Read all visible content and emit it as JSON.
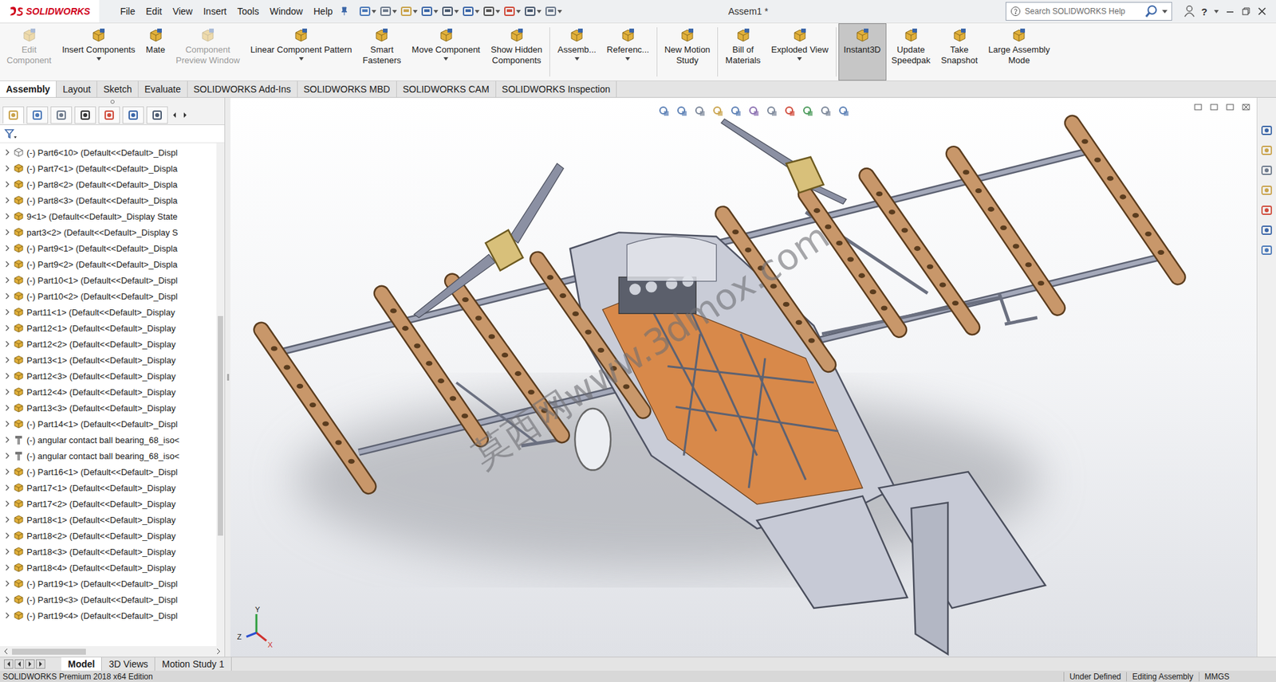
{
  "window": {
    "title": "Assem1 *"
  },
  "app": {
    "logo": "SOLIDWORKS"
  },
  "menu": [
    "File",
    "Edit",
    "View",
    "Insert",
    "Tools",
    "Window",
    "Help"
  ],
  "search": {
    "placeholder": "Search SOLIDWORKS Help"
  },
  "help_button": "?",
  "ribbon": [
    {
      "lines": [
        "Edit",
        "Component"
      ],
      "disabled": true,
      "selected": false,
      "menu": false
    },
    {
      "lines": [
        "Insert Components"
      ],
      "disabled": false,
      "selected": false,
      "menu": true
    },
    {
      "lines": [
        "Mate"
      ],
      "disabled": false,
      "selected": false,
      "menu": false
    },
    {
      "lines": [
        "Component",
        "Preview Window"
      ],
      "disabled": true,
      "selected": false,
      "menu": false
    },
    {
      "lines": [
        "Linear Component Pattern"
      ],
      "disabled": false,
      "selected": false,
      "menu": true
    },
    {
      "lines": [
        "Smart",
        "Fasteners"
      ],
      "disabled": false,
      "selected": false,
      "menu": false
    },
    {
      "lines": [
        "Move Component"
      ],
      "disabled": false,
      "selected": false,
      "menu": true
    },
    {
      "lines": [
        "Show Hidden",
        "Components"
      ],
      "disabled": false,
      "selected": false,
      "menu": false
    },
    {
      "lines": [
        "Assemb..."
      ],
      "disabled": false,
      "selected": false,
      "menu": true
    },
    {
      "lines": [
        "Referenc..."
      ],
      "disabled": false,
      "selected": false,
      "menu": true
    },
    {
      "lines": [
        "New Motion",
        "Study"
      ],
      "disabled": false,
      "selected": false,
      "menu": false
    },
    {
      "lines": [
        "Bill of",
        "Materials"
      ],
      "disabled": false,
      "selected": false,
      "menu": false
    },
    {
      "lines": [
        "Exploded View"
      ],
      "disabled": false,
      "selected": false,
      "menu": true
    },
    {
      "lines": [
        "Instant3D"
      ],
      "disabled": false,
      "selected": true,
      "menu": false
    },
    {
      "lines": [
        "Update",
        "Speedpak"
      ],
      "disabled": false,
      "selected": false,
      "menu": false
    },
    {
      "lines": [
        "Take",
        "Snapshot"
      ],
      "disabled": false,
      "selected": false,
      "menu": false
    },
    {
      "lines": [
        "Large Assembly",
        "Mode"
      ],
      "disabled": false,
      "selected": false,
      "menu": false
    }
  ],
  "tabs": [
    {
      "label": "Assembly",
      "selected": true
    },
    {
      "label": "Layout",
      "selected": false
    },
    {
      "label": "Sketch",
      "selected": false
    },
    {
      "label": "Evaluate",
      "selected": false
    },
    {
      "label": "SOLIDWORKS Add-Ins",
      "selected": false
    },
    {
      "label": "SOLIDWORKS MBD",
      "selected": false
    },
    {
      "label": "SOLIDWORKS CAM",
      "selected": false
    },
    {
      "label": "SOLIDWORKS Inspection",
      "selected": false
    }
  ],
  "tree": [
    {
      "label": "(-) Part6<10> (Default<<Default>_Displ",
      "kind": "outline",
      "expanded": false
    },
    {
      "label": "(-) Part7<1> (Default<<Default>_Displa",
      "kind": "part",
      "expanded": false
    },
    {
      "label": "(-) Part8<2> (Default<<Default>_Displa",
      "kind": "part",
      "expanded": false
    },
    {
      "label": "(-) Part8<3> (Default<<Default>_Displa",
      "kind": "part",
      "expanded": false
    },
    {
      "label": "9<1> (Default<<Default>_Display State",
      "kind": "part",
      "expanded": false
    },
    {
      "label": "part3<2> (Default<<Default>_Display S",
      "kind": "part",
      "expanded": false
    },
    {
      "label": "(-) Part9<1> (Default<<Default>_Displa",
      "kind": "part",
      "expanded": false
    },
    {
      "label": "(-) Part9<2> (Default<<Default>_Displa",
      "kind": "part",
      "expanded": false
    },
    {
      "label": "(-) Part10<1> (Default<<Default>_Displ",
      "kind": "part",
      "expanded": false
    },
    {
      "label": "(-) Part10<2> (Default<<Default>_Displ",
      "kind": "part",
      "expanded": false
    },
    {
      "label": "Part11<1> (Default<<Default>_Display",
      "kind": "part",
      "expanded": false
    },
    {
      "label": "Part12<1> (Default<<Default>_Display",
      "kind": "part",
      "expanded": false
    },
    {
      "label": "Part12<2> (Default<<Default>_Display",
      "kind": "part",
      "expanded": false
    },
    {
      "label": "Part13<1> (Default<<Default>_Display",
      "kind": "part",
      "expanded": false
    },
    {
      "label": "Part12<3> (Default<<Default>_Display",
      "kind": "part",
      "expanded": false
    },
    {
      "label": "Part12<4> (Default<<Default>_Display",
      "kind": "part",
      "expanded": false
    },
    {
      "label": "Part13<3> (Default<<Default>_Display",
      "kind": "part",
      "expanded": false
    },
    {
      "label": "(-) Part14<1> (Default<<Default>_Displ",
      "kind": "part",
      "expanded": false
    },
    {
      "label": "(-) angular contact ball bearing_68_iso<",
      "kind": "bearing",
      "expanded": false
    },
    {
      "label": "(-) angular contact ball bearing_68_iso<",
      "kind": "bearing",
      "expanded": false
    },
    {
      "label": "(-) Part16<1> (Default<<Default>_Displ",
      "kind": "part",
      "expanded": false
    },
    {
      "label": "Part17<1> (Default<<Default>_Display",
      "kind": "part",
      "expanded": false
    },
    {
      "label": "Part17<2> (Default<<Default>_Display",
      "kind": "part",
      "expanded": false
    },
    {
      "label": "Part18<1> (Default<<Default>_Display",
      "kind": "part",
      "expanded": false
    },
    {
      "label": "Part18<2> (Default<<Default>_Display",
      "kind": "part",
      "expanded": false
    },
    {
      "label": "Part18<3> (Default<<Default>_Display",
      "kind": "part",
      "expanded": false
    },
    {
      "label": "Part18<4> (Default<<Default>_Display",
      "kind": "part",
      "expanded": false
    },
    {
      "label": "(-) Part19<1> (Default<<Default>_Displ",
      "kind": "part",
      "expanded": false
    },
    {
      "label": "(-) Part19<3> (Default<<Default>_Displ",
      "kind": "part",
      "expanded": false
    },
    {
      "label": "(-) Part19<4> (Default<<Default>_Displ",
      "kind": "part",
      "expanded": false
    }
  ],
  "triad": {
    "x": "X",
    "y": "Y",
    "z": "Z"
  },
  "watermark": "莫西网www.3dmox.com",
  "bottom_tabs": [
    {
      "label": "Model",
      "selected": true
    },
    {
      "label": "3D Views",
      "selected": false
    },
    {
      "label": "Motion Study 1",
      "selected": false
    }
  ],
  "status_bar": {
    "product": "SOLIDWORKS Premium 2018 x64 Edition",
    "state": "Under Defined",
    "mode": "Editing Assembly",
    "units": "MMGS"
  }
}
